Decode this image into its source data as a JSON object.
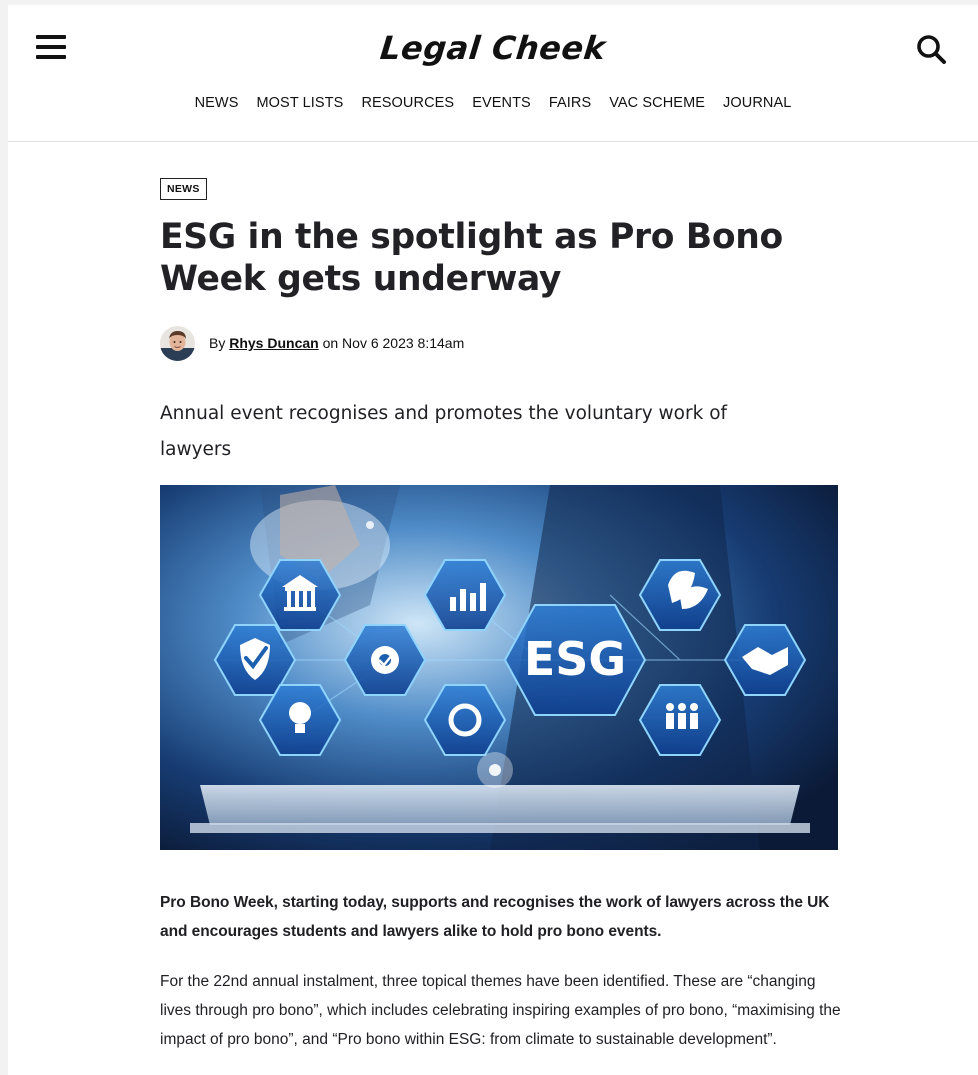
{
  "header": {
    "logo_text": "Legal Cheek",
    "menu_icon": "hamburger-icon",
    "search_icon": "search-icon",
    "nav": [
      "NEWS",
      "MOST LISTS",
      "RESOURCES",
      "EVENTS",
      "FAIRS",
      "VAC SCHEME",
      "JOURNAL"
    ]
  },
  "article": {
    "tag": "NEWS",
    "title": "ESG in the spotlight as Pro Bono Week gets underway",
    "byline_prefix": "By ",
    "author": "Rhys Duncan",
    "date_text": " on Nov 6 2023 8:14am",
    "standfirst": "Annual event recognises and promotes the voluntary work of lawyers",
    "hero_text": "ESG",
    "paragraph_1": "Pro Bono Week, starting today, supports and recognises the work of lawyers across the UK and encourages students and lawyers alike to hold pro bono events.",
    "paragraph_2": "For the 22nd annual instalment, three topical themes have been identified. These are “changing lives through pro bono”, which includes celebrating inspiring examples of pro bono, “maximising the impact of pro bono”, and “Pro bono within ESG: from climate to sustainable development”."
  },
  "colors": {
    "text": "#1f1f24",
    "hero_blue": "#1b5fae",
    "hero_glow": "#7fd4ff"
  }
}
